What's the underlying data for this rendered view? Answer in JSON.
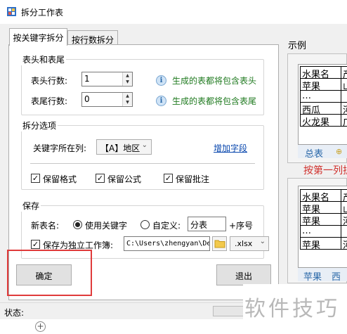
{
  "window": {
    "title": "拆分工作表"
  },
  "tabs": [
    {
      "label": "按关键字拆分",
      "active": true
    },
    {
      "label": "按行数拆分",
      "active": false
    }
  ],
  "header_footer": {
    "title": "表头和表尾",
    "header_rows_label": "表头行数:",
    "header_rows_value": "1",
    "header_hint": "生成的表都将包含表头",
    "footer_rows_label": "表尾行数:",
    "footer_rows_value": "0",
    "footer_hint": "生成的表都将包含表尾"
  },
  "split_options": {
    "title": "拆分选项",
    "key_column_label": "关键字所在列:",
    "key_column_value": "【A】地区",
    "add_field_link": "增加字段",
    "keep_format_label": "保留格式",
    "keep_format_checked": true,
    "keep_formula_label": "保留公式",
    "keep_formula_checked": true,
    "keep_comment_label": "保留批注",
    "keep_comment_checked": true
  },
  "save": {
    "title": "保存",
    "new_table_name_label": "新表名:",
    "use_keyword_label": "使用关键字",
    "use_keyword_selected": true,
    "custom_label": "自定义:",
    "custom_selected": false,
    "custom_value": "分表",
    "suffix_label": "+序号",
    "save_separate_label": "保存为独立工作簿:",
    "save_separate_checked": true,
    "path_value": "C:\\Users\\zhengyan\\De",
    "extension_value": ".xlsx"
  },
  "buttons": {
    "ok": "确定",
    "exit": "退出"
  },
  "status": {
    "label": "状态:"
  },
  "example": {
    "title": "示例",
    "table1": {
      "header": [
        "水果名",
        "产"
      ],
      "rows": [
        [
          "苹果",
          "山"
        ],
        [
          "…",
          ""
        ],
        [
          "西瓜",
          "河"
        ],
        [
          "火龙果",
          "广"
        ]
      ],
      "sheet_tab": "总表"
    },
    "split_caption": "按第一列拆",
    "table2": {
      "header": [
        "水果名",
        "产"
      ],
      "rows": [
        [
          "苹果",
          "山"
        ],
        [
          "苹果",
          "河"
        ],
        [
          "…",
          ""
        ],
        [
          "苹果",
          "河"
        ]
      ],
      "sheet_tabs": [
        "苹果",
        "西瓜"
      ]
    }
  },
  "watermark": "软件技巧"
}
